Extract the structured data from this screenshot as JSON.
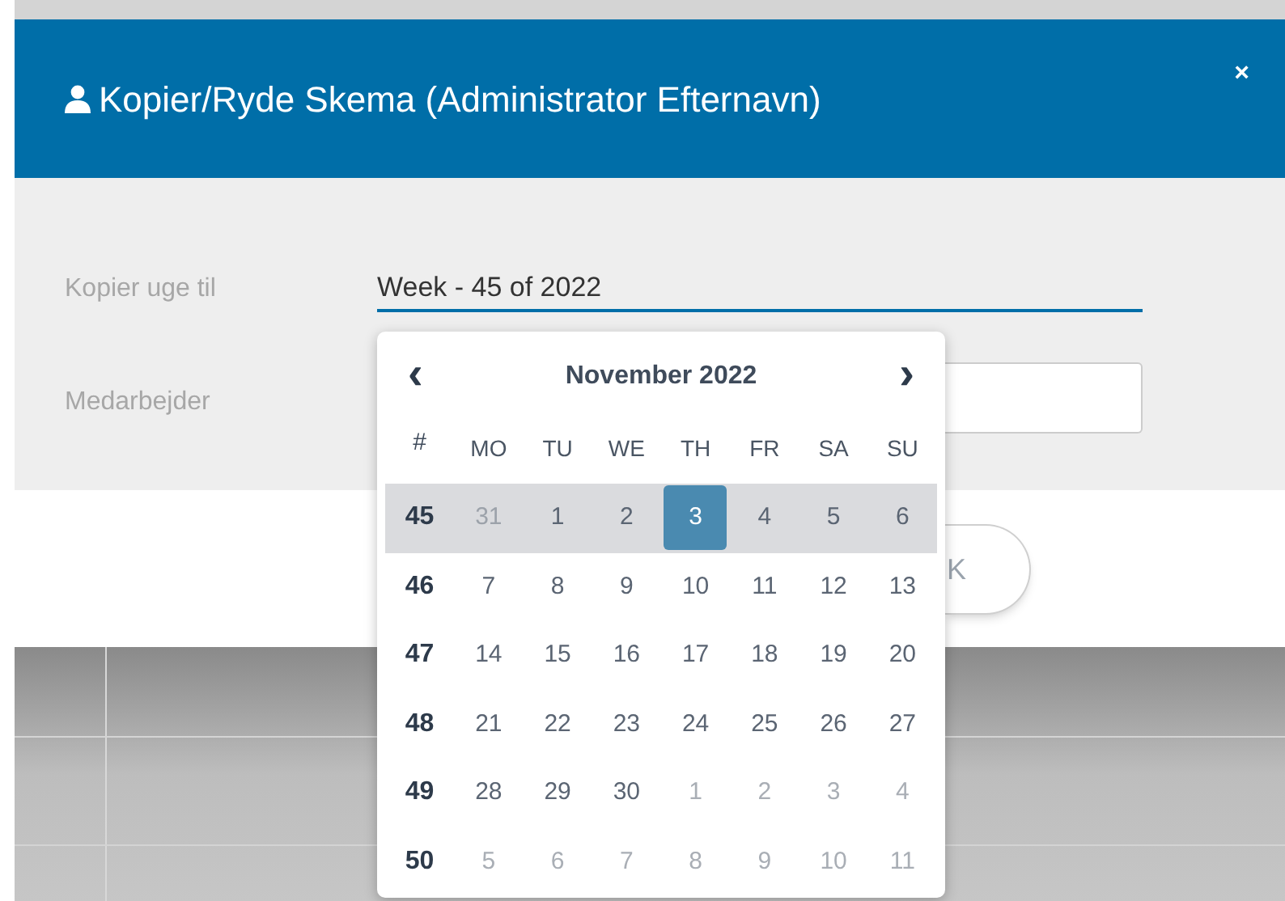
{
  "dialog": {
    "title": "Kopier/Ryde Skema (Administrator Efternavn)",
    "close": "×"
  },
  "fields": [
    {
      "label": "Kopier uge til",
      "value": "Week - 45 of 2022",
      "focused": true
    },
    {
      "label": "Medarbejder",
      "focused": false
    }
  ],
  "footer_button": "K",
  "calendar": {
    "month": "November 2022",
    "prev": "‹",
    "next": "›",
    "week_header": "#",
    "weekdays": [
      "MO",
      "TU",
      "WE",
      "TH",
      "FR",
      "SA",
      "SU"
    ],
    "weeks": [
      {
        "number": "45",
        "selected": true,
        "days": [
          {
            "day": "31",
            "outside": true,
            "selected": false
          },
          {
            "day": "1",
            "outside": false,
            "selected": false
          },
          {
            "day": "2",
            "outside": false,
            "selected": false
          },
          {
            "day": "3",
            "outside": false,
            "selected": true
          },
          {
            "day": "4",
            "outside": false,
            "selected": false
          },
          {
            "day": "5",
            "outside": false,
            "selected": false
          },
          {
            "day": "6",
            "outside": false,
            "selected": false
          }
        ]
      },
      {
        "number": "46",
        "selected": false,
        "days": [
          {
            "day": "7",
            "outside": false,
            "selected": false
          },
          {
            "day": "8",
            "outside": false,
            "selected": false
          },
          {
            "day": "9",
            "outside": false,
            "selected": false
          },
          {
            "day": "10",
            "outside": false,
            "selected": false
          },
          {
            "day": "11",
            "outside": false,
            "selected": false
          },
          {
            "day": "12",
            "outside": false,
            "selected": false
          },
          {
            "day": "13",
            "outside": false,
            "selected": false
          }
        ]
      },
      {
        "number": "47",
        "selected": false,
        "days": [
          {
            "day": "14",
            "outside": false,
            "selected": false
          },
          {
            "day": "15",
            "outside": false,
            "selected": false
          },
          {
            "day": "16",
            "outside": false,
            "selected": false
          },
          {
            "day": "17",
            "outside": false,
            "selected": false
          },
          {
            "day": "18",
            "outside": false,
            "selected": false
          },
          {
            "day": "19",
            "outside": false,
            "selected": false
          },
          {
            "day": "20",
            "outside": false,
            "selected": false
          }
        ]
      },
      {
        "number": "48",
        "selected": false,
        "days": [
          {
            "day": "21",
            "outside": false,
            "selected": false
          },
          {
            "day": "22",
            "outside": false,
            "selected": false
          },
          {
            "day": "23",
            "outside": false,
            "selected": false
          },
          {
            "day": "24",
            "outside": false,
            "selected": false
          },
          {
            "day": "25",
            "outside": false,
            "selected": false
          },
          {
            "day": "26",
            "outside": false,
            "selected": false
          },
          {
            "day": "27",
            "outside": false,
            "selected": false
          }
        ]
      },
      {
        "number": "49",
        "selected": false,
        "days": [
          {
            "day": "28",
            "outside": false,
            "selected": false
          },
          {
            "day": "29",
            "outside": false,
            "selected": false
          },
          {
            "day": "30",
            "outside": false,
            "selected": false
          },
          {
            "day": "1",
            "outside": true,
            "selected": false
          },
          {
            "day": "2",
            "outside": true,
            "selected": false
          },
          {
            "day": "3",
            "outside": true,
            "selected": false
          },
          {
            "day": "4",
            "outside": true,
            "selected": false
          }
        ]
      },
      {
        "number": "50",
        "selected": false,
        "days": [
          {
            "day": "5",
            "outside": true,
            "selected": false
          },
          {
            "day": "6",
            "outside": true,
            "selected": false
          },
          {
            "day": "7",
            "outside": true,
            "selected": false
          },
          {
            "day": "8",
            "outside": true,
            "selected": false
          },
          {
            "day": "9",
            "outside": true,
            "selected": false
          },
          {
            "day": "10",
            "outside": true,
            "selected": false
          },
          {
            "day": "11",
            "outside": true,
            "selected": false
          }
        ]
      }
    ]
  }
}
